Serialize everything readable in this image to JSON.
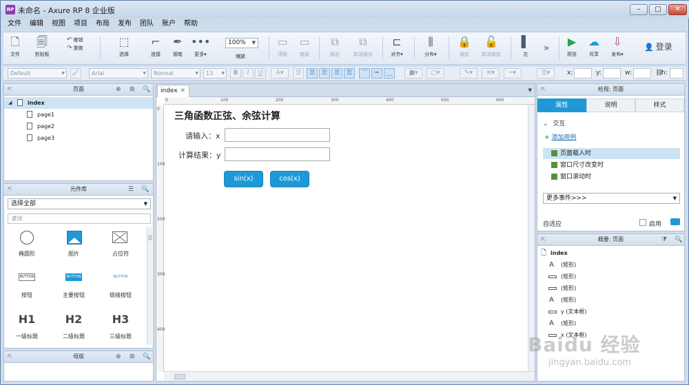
{
  "window": {
    "title": "未命名 - Axure RP 8 企业版",
    "logo": "RP",
    "controls": [
      "minimize-icon",
      "maximize-icon",
      "close-icon"
    ]
  },
  "menu": [
    "文件",
    "编辑",
    "视图",
    "项目",
    "布局",
    "发布",
    "团队",
    "账户",
    "帮助"
  ],
  "toolbar": {
    "file": "文件",
    "clipboard": "剪贴板",
    "cut": "剪切",
    "copy": "复制",
    "paste_undo": "撤销",
    "redo": "重做",
    "select": "选择",
    "connect": "连接",
    "pen": "钢笔",
    "more": "更多▾",
    "zoom_value": "100%",
    "zoom_label": "缩放",
    "top": "顶层",
    "bottom": "底层",
    "group": "组合",
    "ungroup": "取消组合",
    "align": "对齐▾",
    "distribute": "分布▾",
    "lock": "锁定",
    "unlock": "取消锁定",
    "left": "左",
    "preview": "预览",
    "share": "共享",
    "publish": "发布▾",
    "login": "登录"
  },
  "formatbar": {
    "style": "Default",
    "font": "Arial",
    "weight": "Normal",
    "size": "13",
    "x_label": "x:",
    "y_label": "y:",
    "w_label": "w:",
    "h_label": "h:"
  },
  "pages_panel": {
    "title": "页面",
    "items": [
      {
        "label": "index",
        "level": 0,
        "selected": true
      },
      {
        "label": "page1",
        "level": 1
      },
      {
        "label": "page2",
        "level": 1
      },
      {
        "label": "page3",
        "level": 1
      }
    ]
  },
  "library_panel": {
    "title": "元件库",
    "select_value": "选择全部",
    "search_placeholder": "查找",
    "widgets": [
      {
        "label": "椭圆形",
        "icon": "ellipse-icon"
      },
      {
        "label": "图片",
        "icon": "image-icon"
      },
      {
        "label": "占位符",
        "icon": "placeholder-icon"
      },
      {
        "label": "按钮",
        "icon": "button-icon",
        "text": "BUTTON"
      },
      {
        "label": "主要按钮",
        "icon": "primary-button-icon",
        "text": "BUTTON"
      },
      {
        "label": "链接按钮",
        "icon": "link-button-icon",
        "text": "BUTTON"
      },
      {
        "label": "一级标题",
        "icon": "h1-icon",
        "text": "H1"
      },
      {
        "label": "二级标题",
        "icon": "h2-icon",
        "text": "H2"
      },
      {
        "label": "三级标题",
        "icon": "h3-icon",
        "text": "H3"
      }
    ]
  },
  "masters_panel": {
    "title": "母版"
  },
  "canvas": {
    "tab": "index",
    "ruler_h": [
      "0",
      "100",
      "200",
      "300",
      "400",
      "500",
      "600"
    ],
    "ruler_v": [
      "0",
      "100",
      "200",
      "300",
      "400"
    ],
    "title": "三角函数正弦、余弦计算",
    "input_label": "请输入：x",
    "result_label": "计算结果：y",
    "sin_button": "sin(x)",
    "cos_button": "cos(x)",
    "button_color": "#1f98d6"
  },
  "inspector": {
    "title": "检视: 页面",
    "tabs": [
      "属性",
      "说明",
      "样式"
    ],
    "interaction": "交互",
    "add_case": "添加用例",
    "events": [
      "页面载入时",
      "窗口尺寸改变时",
      "窗口滚动时"
    ],
    "more_events": "更多事件>>>",
    "adaptive": "自适应",
    "enable": "启用"
  },
  "outline": {
    "title": "概要: 页面",
    "items": [
      {
        "label": "index",
        "icon": "page-icon"
      },
      {
        "label": "(矩形)",
        "icon": "text-icon"
      },
      {
        "label": "(矩形)",
        "icon": "rectangle-icon"
      },
      {
        "label": "(矩形)",
        "icon": "rectangle-icon"
      },
      {
        "label": "(矩形)",
        "icon": "text-icon"
      },
      {
        "label": "y (文本框)",
        "icon": "textbox-icon"
      },
      {
        "label": "(矩形)",
        "icon": "text-icon"
      },
      {
        "label": "x (文本框)",
        "icon": "textbox-icon"
      }
    ]
  },
  "watermark": {
    "brand": "Baidu 经验",
    "url": "jingyan.baidu.com"
  }
}
